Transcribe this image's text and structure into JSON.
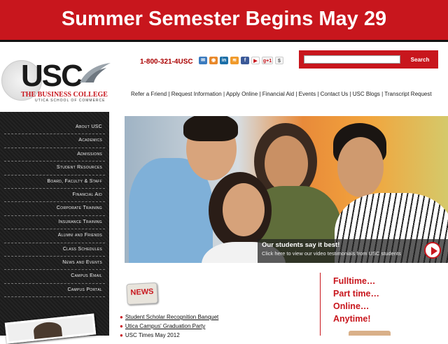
{
  "banner": {
    "text": "Summer Semester Begins May 29"
  },
  "header": {
    "logo_text": "USC",
    "logo_tagline": "THE BUSINESS COLLEGE",
    "logo_subtitle": "UTICA SCHOOL OF COMMERCE",
    "phone": "1-800-321-4USC",
    "social_icons": [
      "email-icon",
      "rss-icon",
      "linkedin-icon",
      "feed-icon",
      "facebook-icon",
      "youtube-icon",
      "google-plus-icon",
      "dollar-icon"
    ],
    "social_labels": [
      "",
      "",
      "in",
      "",
      "f",
      "",
      "g+1",
      "$"
    ]
  },
  "search": {
    "placeholder": "",
    "button_label": "Search"
  },
  "topnav": {
    "items": [
      "Refer a Friend",
      "Request Information",
      "Apply Online",
      "Financial Aid",
      "Events",
      "Contact Us",
      "USC Blogs",
      "Transcript Request"
    ],
    "separator": "|"
  },
  "sidebar": {
    "items": [
      "About USC",
      "Academics",
      "Admissions",
      "Student Resources",
      "Board, Faculty & Staff",
      "Financial Aid",
      "Corporate Training",
      "Insurance Training",
      "Alumni and Friends",
      "Class Schedules",
      "News and Events",
      "Campus Email",
      "Campus Portal"
    ]
  },
  "hero": {
    "caption_title": "Our students say it best!",
    "caption_sub": "Click here to view our video testimonials from USC students"
  },
  "news": {
    "badge": "NEWS",
    "items": [
      "Student Scholar Recognition Banquet",
      "Utica Campus' Graduation Party",
      "USC Times May 2012"
    ]
  },
  "taglines": [
    "Fulltime…",
    "Part time…",
    "Online…",
    "Anytime!"
  ],
  "colors": {
    "brand_red": "#c8161d",
    "sidebar_bg": "#1f1f1f",
    "text_dark": "#222222"
  }
}
